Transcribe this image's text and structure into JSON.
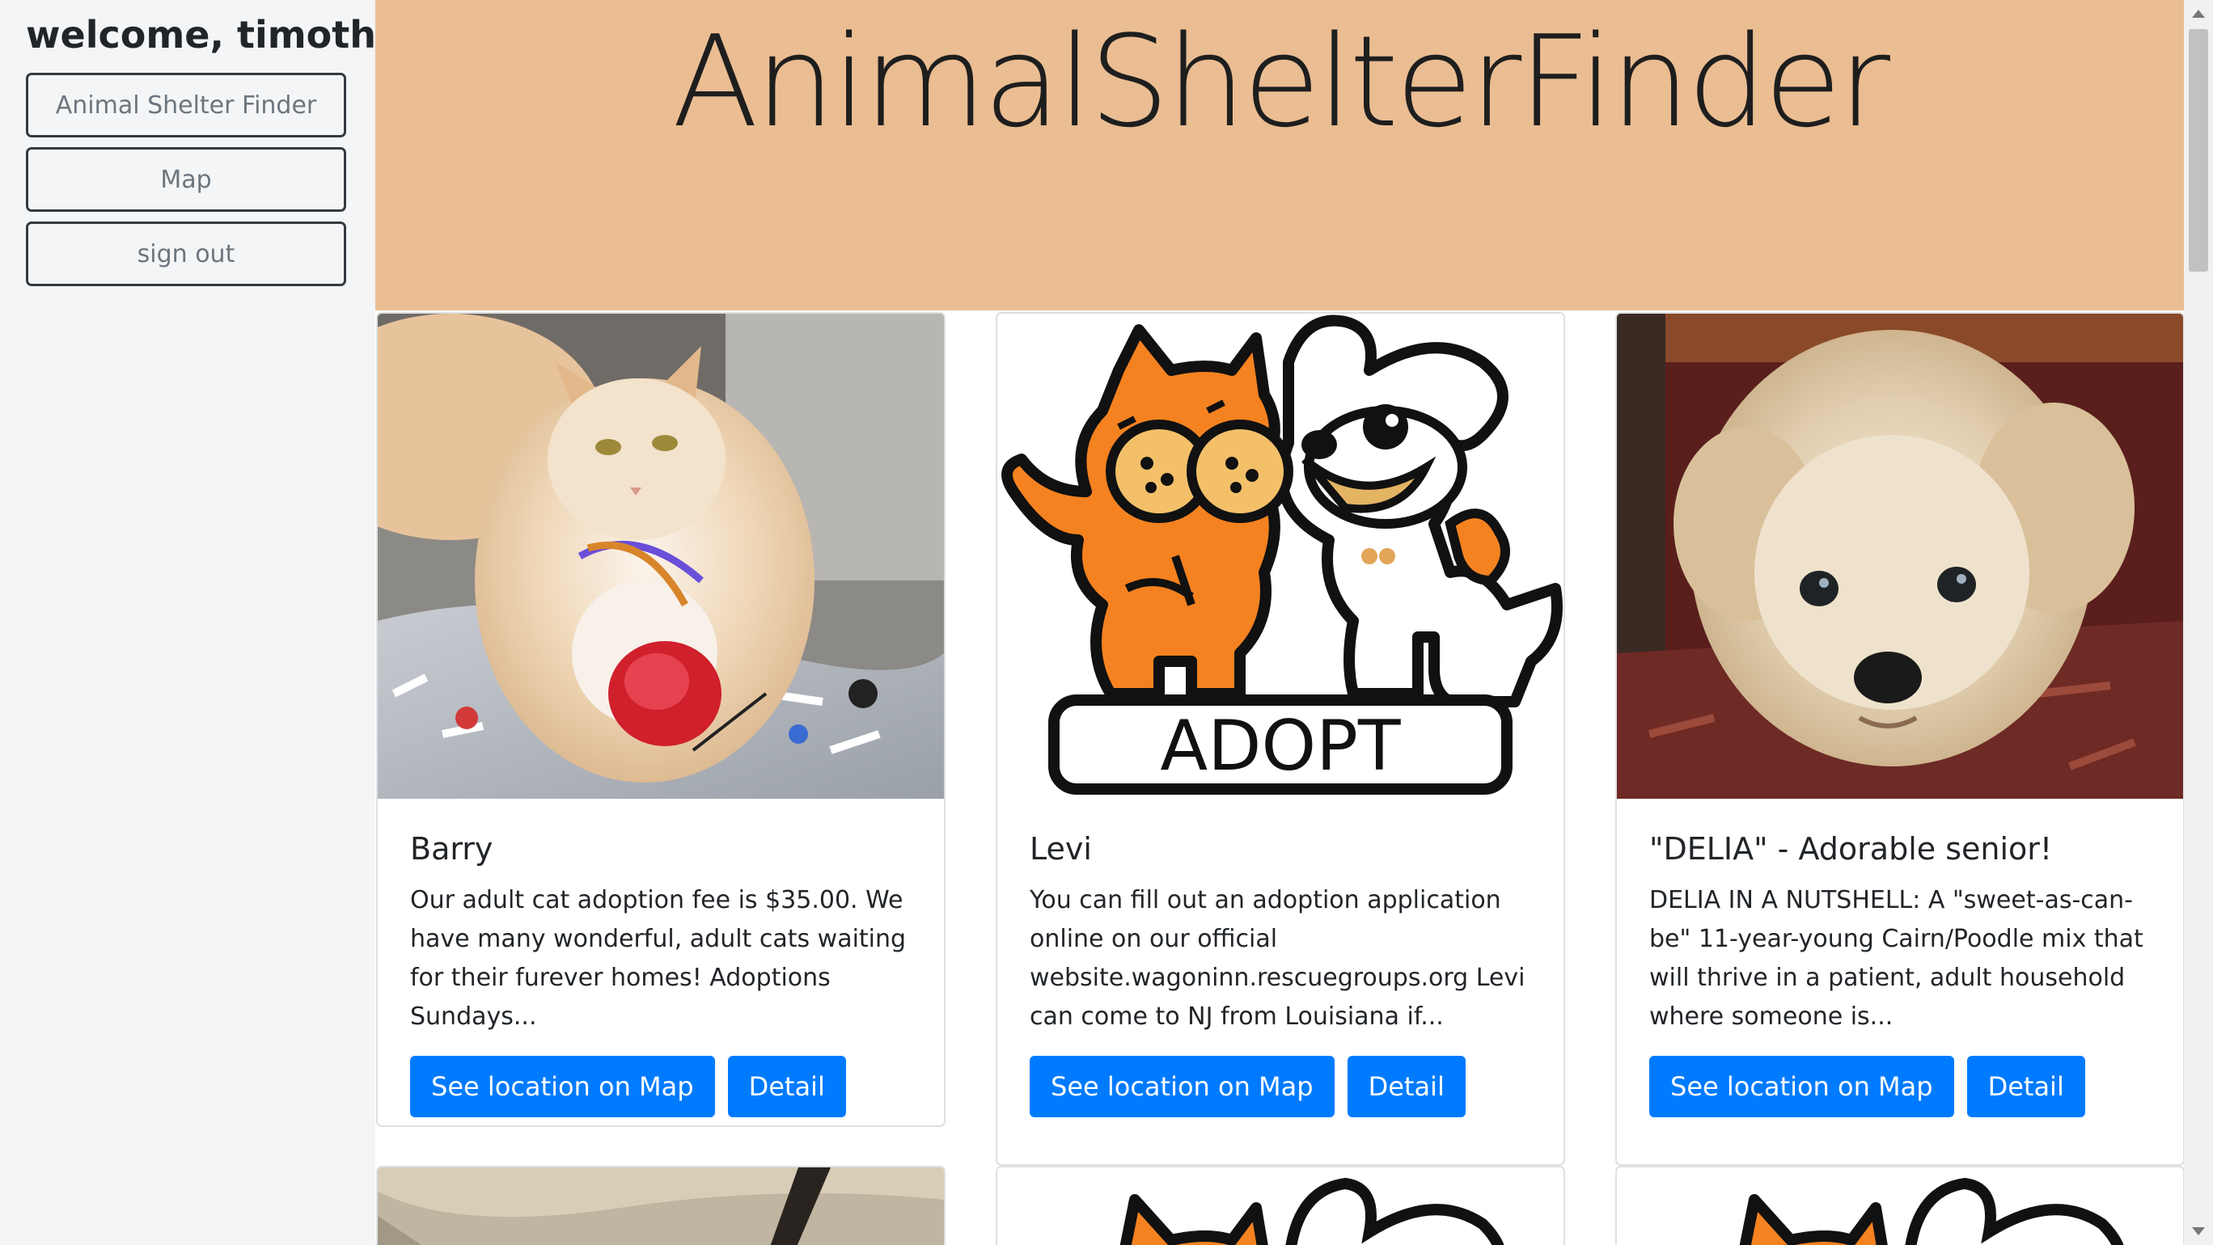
{
  "sidebar": {
    "welcome": "welcome, timothy",
    "nav": [
      {
        "label": "Animal Shelter Finder"
      },
      {
        "label": "Map"
      },
      {
        "label": "sign out"
      }
    ]
  },
  "header": {
    "title": "AnimalShelterFinder"
  },
  "cards": [
    {
      "title": "Barry",
      "text": "Our adult cat adoption fee is $35.00. We have many wonderful, adult cats waiting for their furever homes! Adoptions Sundays...",
      "map_button": "See location on Map",
      "detail_button": "Detail"
    },
    {
      "title": "Levi",
      "text": "You can fill out an adoption application online on our official website.wagoninn.rescuegroups.org Levi can come to NJ from Louisiana if...",
      "map_button": "See location on Map",
      "detail_button": "Detail",
      "image_label": "ADOPT"
    },
    {
      "title": "\"DELIA\" - Adorable senior!",
      "text": "DELIA IN A NUTSHELL: A \"sweet-as-can-be\" 11-year-young Cairn/Poodle mix that will thrive in a patient, adult household where someone is...",
      "map_button": "See location on Map",
      "detail_button": "Detail"
    }
  ],
  "colors": {
    "banner": "#eabd92",
    "primary": "#007bff",
    "sidebar_bg": "#f4f5f7",
    "adopt_orange": "#f58220"
  }
}
